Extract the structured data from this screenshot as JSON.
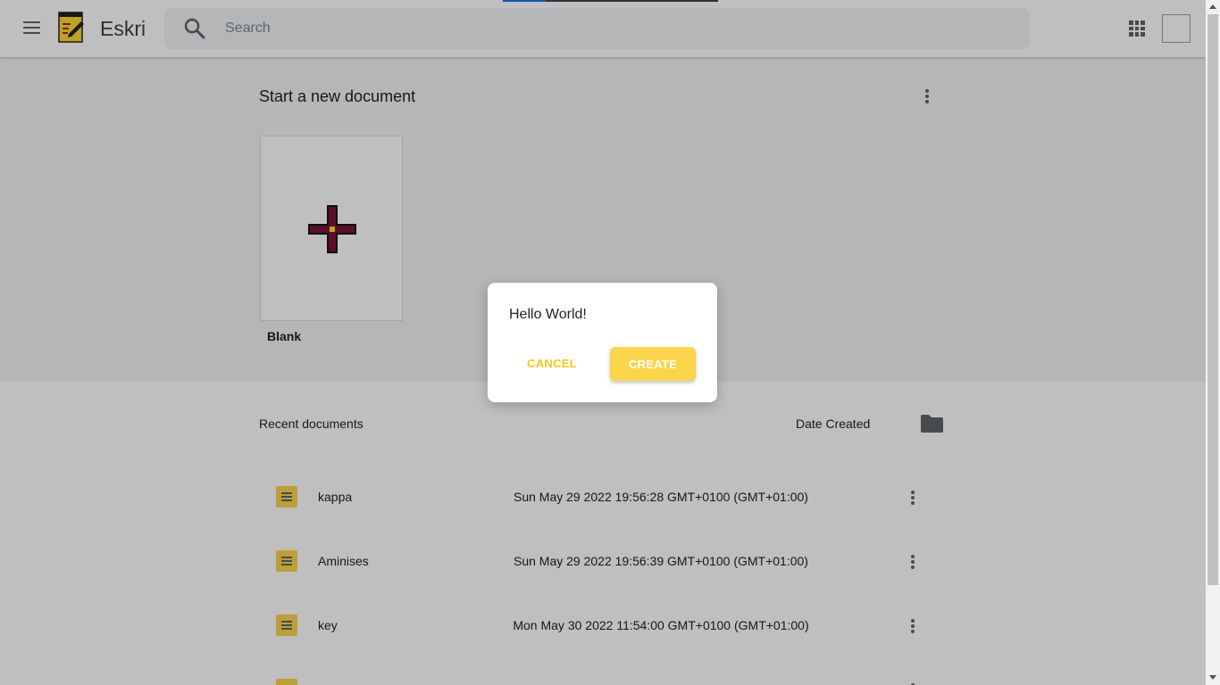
{
  "header": {
    "app_name": "Eskri",
    "search_placeholder": "Search"
  },
  "new_document": {
    "title": "Start a new document",
    "templates": [
      {
        "label": "Blank"
      }
    ]
  },
  "recent": {
    "title": "Recent documents",
    "sort_label": "Date Created",
    "documents": [
      {
        "name": "kappa",
        "date": "Sun May 29 2022 19:56:28 GMT+0100 (GMT+01:00)"
      },
      {
        "name": "Aminises",
        "date": "Sun May 29 2022 19:56:39 GMT+0100 (GMT+01:00)"
      },
      {
        "name": "key",
        "date": "Mon May 30 2022 11:54:00 GMT+0100 (GMT+01:00)"
      }
    ]
  },
  "dialog": {
    "message": "Hello World!",
    "cancel_label": "CANCEL",
    "create_label": "CREATE"
  },
  "icons": {
    "menu": "hamburger-menu-icon",
    "logo": "notepad-pencil-logo",
    "search": "search-icon",
    "apps": "apps-grid-icon",
    "more": "more-vert-icon",
    "folder": "folder-icon",
    "document": "document-icon",
    "plus": "plus-icon"
  },
  "colors": {
    "accent": "#fbd54b",
    "accent_text": "#f5c518",
    "overlay": "rgba(0,0,0,0.25)"
  }
}
